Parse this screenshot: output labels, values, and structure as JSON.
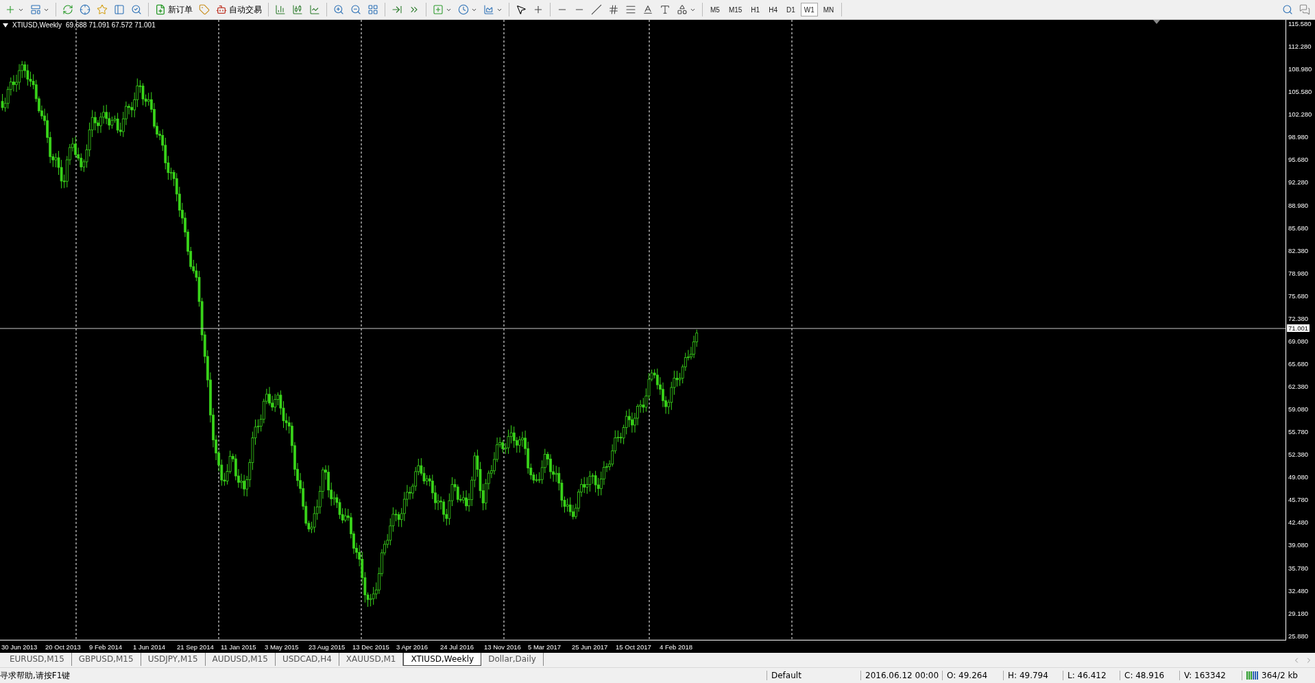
{
  "toolbar": {
    "new_order": "新订单",
    "auto_trading": "自动交易",
    "timeframes": [
      {
        "label": "M5",
        "selected": false
      },
      {
        "label": "M15",
        "selected": false
      },
      {
        "label": "H1",
        "selected": false
      },
      {
        "label": "H4",
        "selected": false
      },
      {
        "label": "D1",
        "selected": false
      },
      {
        "label": "W1",
        "selected": true
      },
      {
        "label": "MN",
        "selected": false
      }
    ]
  },
  "chart": {
    "symbol": "XTIUSD,Weekly",
    "ohlc": "69.688 71.091 67.572 71.001",
    "current_price": "71.001",
    "price_axis": [
      "115.580",
      "112.280",
      "108.980",
      "105.580",
      "102.280",
      "98.980",
      "95.680",
      "92.280",
      "88.980",
      "85.680",
      "82.380",
      "78.980",
      "75.680",
      "72.380",
      "69.080",
      "65.680",
      "62.380",
      "59.080",
      "55.780",
      "52.380",
      "49.080",
      "45.780",
      "42.480",
      "39.080",
      "35.780",
      "32.480",
      "29.180",
      "25.880"
    ],
    "time_axis": [
      "30 Jun 2013",
      "20 Oct 2013",
      "9 Feb 2014",
      "1 Jun 2014",
      "21 Sep 2014",
      "11 Jan 2015",
      "3 May 2015",
      "23 Aug 2015",
      "13 Dec 2015",
      "3 Apr 2016",
      "24 Jul 2016",
      "13 Nov 2016",
      "5 Mar 2017",
      "25 Jun 2017",
      "15 Oct 2017",
      "4 Feb 2018"
    ]
  },
  "tabs": [
    {
      "label": "EURUSD,M15",
      "selected": false
    },
    {
      "label": "GBPUSD,M15",
      "selected": false
    },
    {
      "label": "USDJPY,M15",
      "selected": false
    },
    {
      "label": "AUDUSD,M15",
      "selected": false
    },
    {
      "label": "USDCAD,H4",
      "selected": false
    },
    {
      "label": "XAUUSD,M1",
      "selected": false
    },
    {
      "label": "XTIUSD,Weekly",
      "selected": true
    },
    {
      "label": "Dollar,Daily",
      "selected": false
    }
  ],
  "status_bar": {
    "help": "寻求帮助,请按F1键",
    "profile": "Default",
    "time": "2016.06.12 00:00",
    "open": "O: 49.264",
    "high": "H: 49.794",
    "low": "L: 46.412",
    "close": "C: 48.916",
    "volume": "V: 163342",
    "traffic": "364/2 kb"
  }
}
